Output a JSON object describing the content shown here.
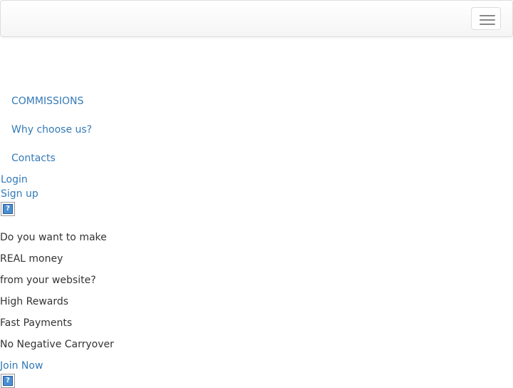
{
  "navbar": {
    "toggle_icon": "hamburger-menu-icon"
  },
  "nav_menu": {
    "items": [
      {
        "label": "COMMISSIONS"
      },
      {
        "label": "Why choose us?"
      },
      {
        "label": "Contacts"
      }
    ]
  },
  "account": {
    "login_label": "Login",
    "signup_label": "Sign up"
  },
  "images": {
    "broken_icon": "broken-image-icon",
    "broken_glyph": "?"
  },
  "hero": {
    "lines": [
      "Do you want to make",
      "REAL money",
      "from your website?"
    ],
    "features": [
      "High Rewards",
      "Fast Payments",
      "No Negative Carryover"
    ],
    "cta_label": "Join Now"
  },
  "colors": {
    "link": "#337ab7",
    "text": "#333333",
    "navbar_border": "#dddddd"
  }
}
